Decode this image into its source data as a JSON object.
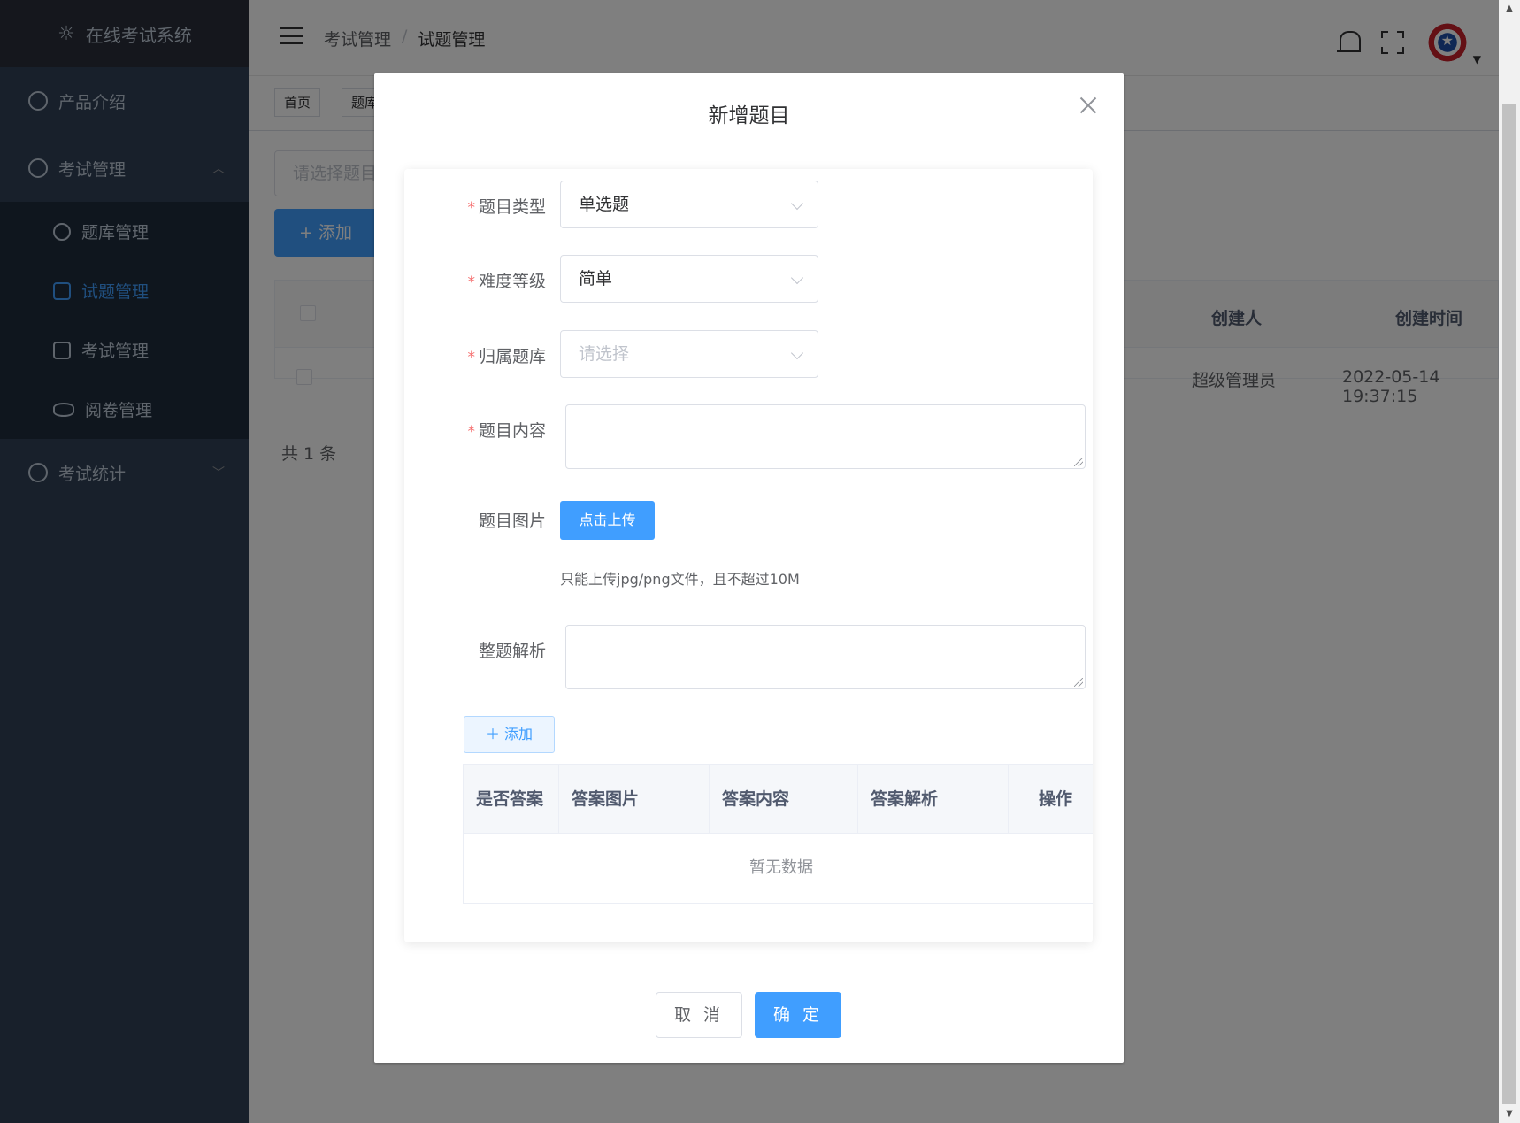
{
  "app": {
    "title": "在线考试系统",
    "logo_icon": "sun-icon"
  },
  "sidebar": {
    "items": [
      {
        "label": "产品介绍",
        "icon": "gauge-icon"
      },
      {
        "label": "考试管理",
        "icon": "ring-icon",
        "expanded": true,
        "children": [
          {
            "label": "题库管理",
            "icon": "crosshair-icon",
            "active": false
          },
          {
            "label": "试题管理",
            "icon": "edit-icon",
            "active": true
          },
          {
            "label": "考试管理",
            "icon": "document-icon",
            "active": false
          },
          {
            "label": "阅卷管理",
            "icon": "eye-icon",
            "active": false
          }
        ]
      },
      {
        "label": "考试统计",
        "icon": "pie-chart-icon"
      }
    ]
  },
  "header": {
    "breadcrumb": [
      "考试管理",
      "试题管理"
    ],
    "separator": "/"
  },
  "tags": [
    "首页",
    "题库"
  ],
  "page": {
    "search_placeholder": "请选择题目",
    "add_button": "+ 添加",
    "table": {
      "headers": [
        "创建人",
        "创建时间"
      ],
      "rows": [
        {
          "creator": "超级管理员",
          "created_at": "2022-05-14 19:37:15"
        }
      ]
    },
    "total_text": "共 1 条"
  },
  "dialog": {
    "title": "新增题目",
    "fields": {
      "type": {
        "label": "题目类型",
        "value": "单选题",
        "required": true
      },
      "difficulty": {
        "label": "难度等级",
        "value": "简单",
        "required": true
      },
      "bank": {
        "label": "归属题库",
        "placeholder": "请选择",
        "required": true
      },
      "content": {
        "label": "题目内容",
        "required": true
      },
      "image": {
        "label": "题目图片",
        "button": "点击上传",
        "tip": "只能上传jpg/png文件，且不超过10M"
      },
      "analysis": {
        "label": "整题解析"
      }
    },
    "add_answer_button": "添加",
    "answer_table": {
      "headers": [
        "是否答案",
        "答案图片",
        "答案内容",
        "答案解析",
        "操作"
      ],
      "empty_text": "暂无数据"
    },
    "cancel": "取 消",
    "confirm": "确 定"
  },
  "colors": {
    "primary": "#409eff",
    "sidebar": "#304156",
    "required": "#f56c6c"
  }
}
